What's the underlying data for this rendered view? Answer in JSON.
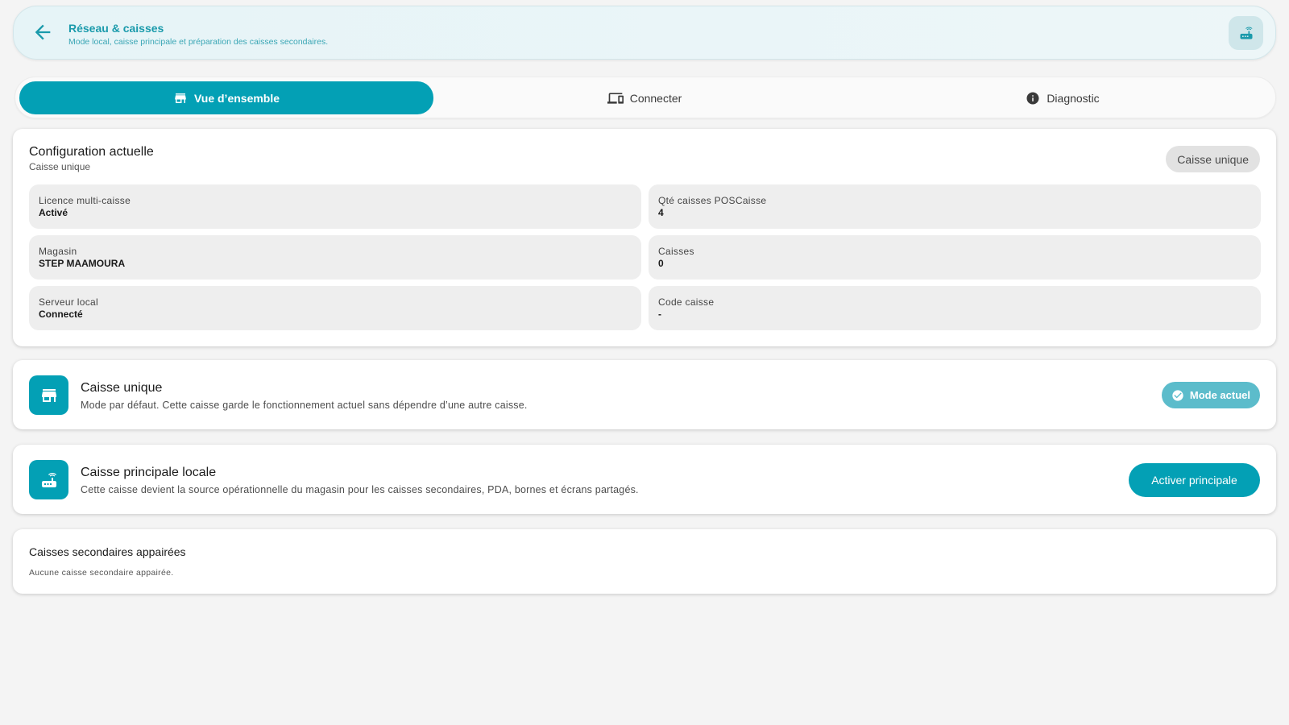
{
  "header": {
    "title": "Réseau & caisses",
    "subtitle": "Mode local, caisse principale et préparation des caisses secondaires.",
    "back_icon": "arrow-left-icon",
    "action_icon": "router-icon"
  },
  "tabs": [
    {
      "label": "Vue d’ensemble",
      "icon": "store-icon",
      "active": true
    },
    {
      "label": "Connecter",
      "icon": "devices-icon",
      "active": false
    },
    {
      "label": "Diagnostic",
      "icon": "info-icon",
      "active": false
    }
  ],
  "config": {
    "title": "Configuration actuelle",
    "subtitle": "Caisse unique",
    "badge": "Caisse unique",
    "items": [
      {
        "label": "Licence multi-caisse",
        "value": "Activé"
      },
      {
        "label": "Qté caisses POSCaisse",
        "value": "4"
      },
      {
        "label": "Magasin",
        "value": "STEP MAAMOURA"
      },
      {
        "label": "Caisses",
        "value": "0"
      },
      {
        "label": "Serveur local",
        "value": "Connecté"
      },
      {
        "label": "Code caisse",
        "value": "-"
      }
    ]
  },
  "modes": [
    {
      "title": "Caisse unique",
      "description": "Mode par défaut. Cette caisse garde le fonctionnement actuel sans dépendre d’une autre caisse.",
      "icon": "store-icon",
      "status_label": "Mode actuel"
    },
    {
      "title": "Caisse principale locale",
      "description": "Cette caisse devient la source opérationnelle du magasin pour les caisses secondaires, PDA, bornes et écrans partagés.",
      "icon": "router-icon",
      "action_label": "Activer principale"
    }
  ],
  "paired": {
    "title": "Caisses secondaires appairées",
    "empty_text": "Aucune caisse secondaire appairée."
  },
  "colors": {
    "accent": "#03a0b5",
    "accent_light": "#5cbccb",
    "background": "#f4f4f4"
  }
}
